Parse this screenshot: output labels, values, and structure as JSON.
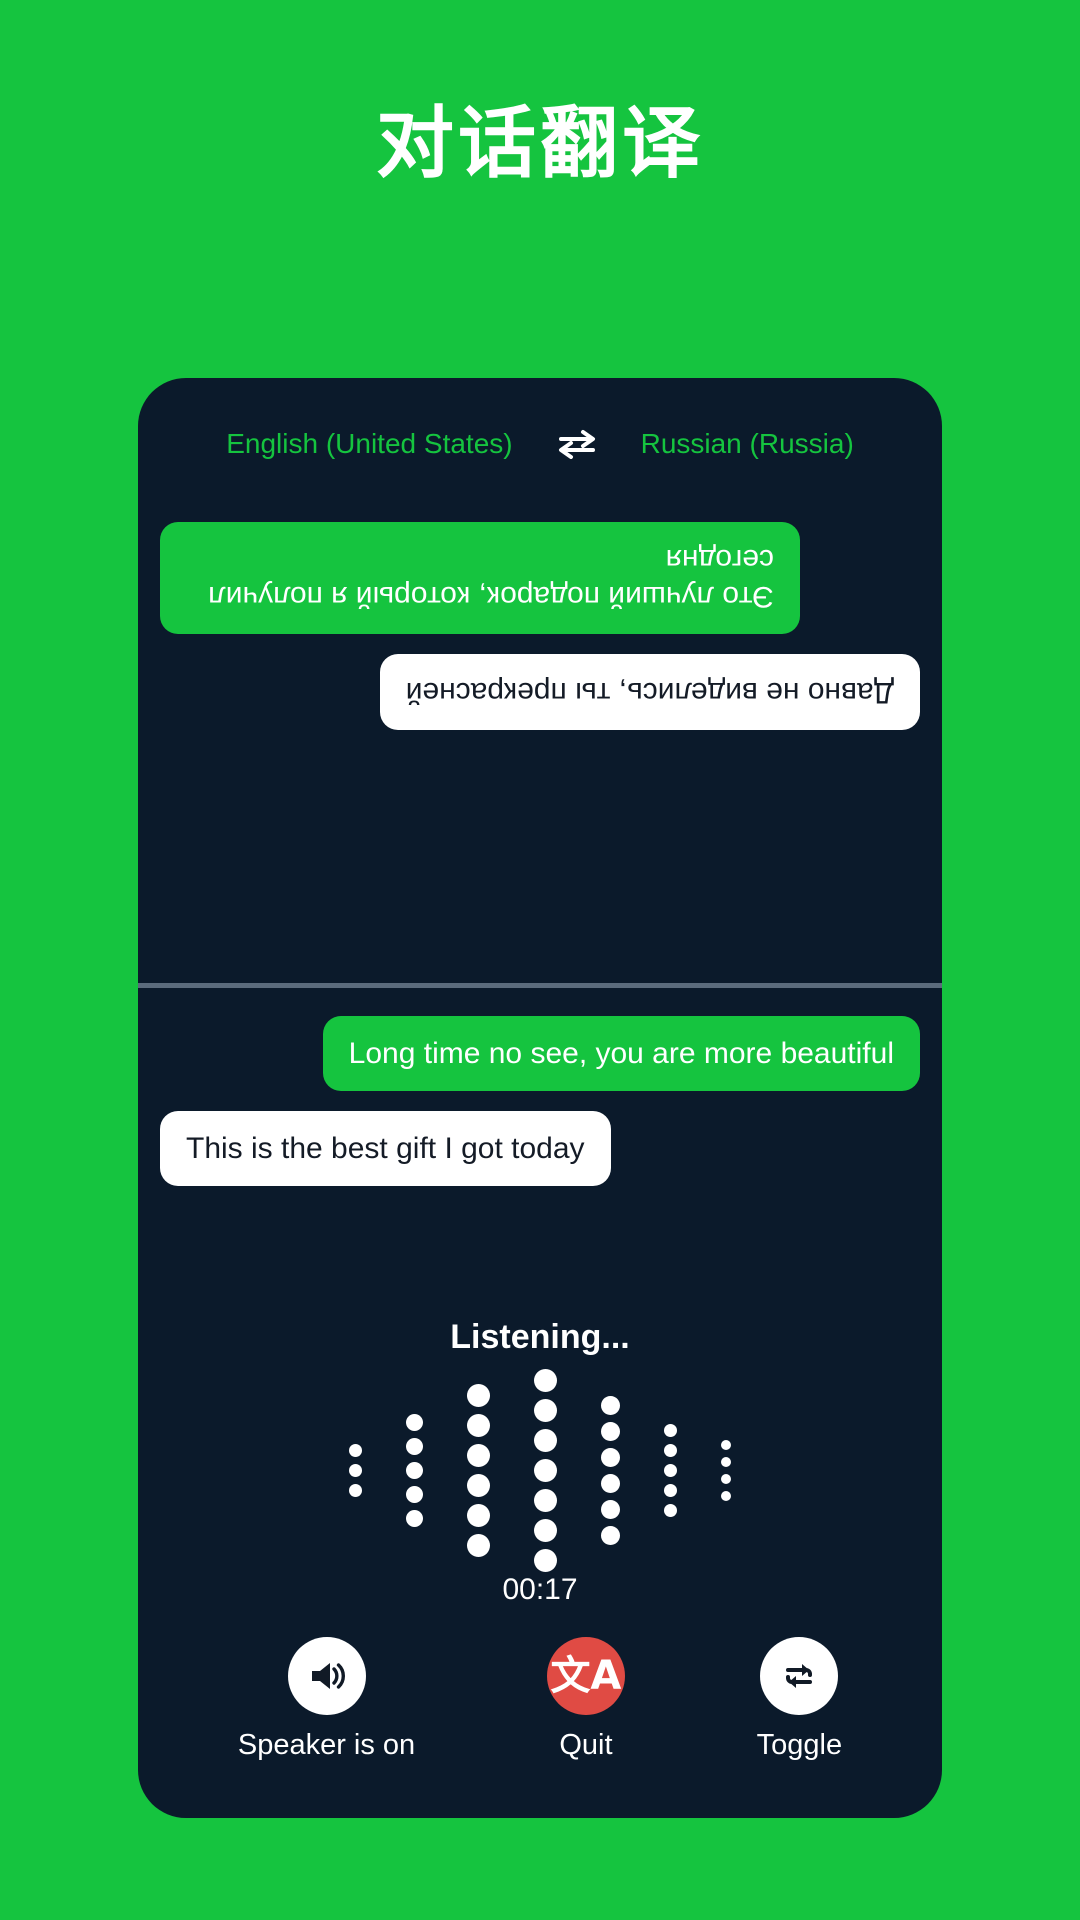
{
  "theme": {
    "background_green": "#15C43F",
    "card_navy": "#0B1A2B",
    "bubble_green": "#15C43F",
    "bubble_white": "#FFFFFF",
    "quit_red": "#E04B44",
    "divider_gray": "#5B6B7C"
  },
  "page": {
    "title": "对话翻译"
  },
  "language_bar": {
    "source_language": "English (United States)",
    "swap_icon": "swap-horizontal-icon",
    "target_language": "Russian (Russia)"
  },
  "conversation": {
    "top_pane_rotated": true,
    "top_messages": [
      {
        "text": "Это лучший подарок, который я получил сегодня",
        "style": "green",
        "align": "right"
      },
      {
        "text": "Давно не виделись, ты прекрасней",
        "style": "white",
        "align": "left"
      }
    ],
    "bottom_messages": [
      {
        "text": "Long time no see, you are more beautiful",
        "style": "green",
        "align": "right"
      },
      {
        "text": "This is the best gift I got today",
        "style": "white",
        "align": "left"
      }
    ]
  },
  "listening": {
    "label": "Listening...",
    "timer": "00:17",
    "waveform": {
      "columns": [
        {
          "dots": 3,
          "size": 13
        },
        {
          "dots": 5,
          "size": 17
        },
        {
          "dots": 6,
          "size": 23
        },
        {
          "dots": 7,
          "size": 23
        },
        {
          "dots": 6,
          "size": 19
        },
        {
          "dots": 5,
          "size": 13
        },
        {
          "dots": 4,
          "size": 10
        }
      ]
    }
  },
  "controls": [
    {
      "label": "Speaker is on",
      "icon": "speaker-on-icon",
      "circle": "white"
    },
    {
      "label": "Quit",
      "icon": "translate-icon",
      "circle": "red"
    },
    {
      "label": "Toggle",
      "icon": "swap-loop-icon",
      "circle": "white"
    }
  ]
}
